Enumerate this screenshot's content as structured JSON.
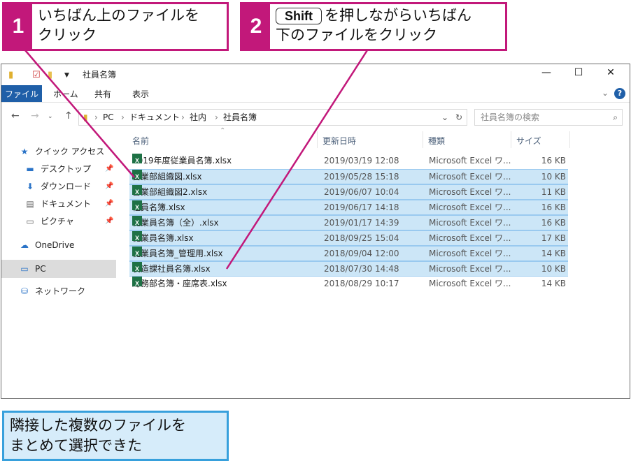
{
  "callouts": {
    "step1": {
      "num": "1",
      "text": "いちばん上のファイルを\nクリック"
    },
    "step2": {
      "num": "2",
      "key": "Shift",
      "text": "を押しながらいちばん",
      "text2": "下のファイルをクリック"
    },
    "result": "隣接した複数のファイルを\nまとめて選択できた"
  },
  "window": {
    "title": "社員名簿",
    "buttons": {
      "minimize": "—",
      "maximize": "☐",
      "close": "✕"
    },
    "ribbon_tabs": [
      "ファイル",
      "ホーム",
      "共有",
      "表示"
    ],
    "help": "?",
    "breadcrumb": [
      "PC",
      "ドキュメント",
      "社内",
      "社員名簿"
    ],
    "search_placeholder": "社員名簿の検索"
  },
  "nav": {
    "quick_access": "クイック アクセス",
    "items": [
      "デスクトップ",
      "ダウンロード",
      "ドキュメント",
      "ピクチャ"
    ],
    "onedrive": "OneDrive",
    "pc": "PC",
    "network": "ネットワーク"
  },
  "columns": {
    "name": "名前",
    "date": "更新日時",
    "type": "種類",
    "size": "サイズ"
  },
  "files": [
    {
      "name": "2019年度従業員名簿.xlsx",
      "date": "2019/03/19 12:08",
      "type": "Microsoft Excel ワ...",
      "size": "16 KB",
      "selected": false
    },
    {
      "name": "営業部組織図.xlsx",
      "date": "2019/05/28 15:18",
      "type": "Microsoft Excel ワ...",
      "size": "10 KB",
      "selected": true
    },
    {
      "name": "営業部組織図2.xlsx",
      "date": "2019/06/07 10:04",
      "type": "Microsoft Excel ワ...",
      "size": "11 KB",
      "selected": true
    },
    {
      "name": "社員名簿.xlsx",
      "date": "2019/06/17 14:18",
      "type": "Microsoft Excel ワ...",
      "size": "16 KB",
      "selected": true
    },
    {
      "name": "従業員名簿（全）.xlsx",
      "date": "2019/01/17 14:39",
      "type": "Microsoft Excel ワ...",
      "size": "16 KB",
      "selected": true
    },
    {
      "name": "従業員名簿.xlsx",
      "date": "2018/09/25 15:04",
      "type": "Microsoft Excel ワ...",
      "size": "17 KB",
      "selected": true
    },
    {
      "name": "従業員名簿_管理用.xlsx",
      "date": "2018/09/04 12:00",
      "type": "Microsoft Excel ワ...",
      "size": "14 KB",
      "selected": true
    },
    {
      "name": "製造課社員名簿.xlsx",
      "date": "2018/07/30 14:48",
      "type": "Microsoft Excel ワ...",
      "size": "10 KB",
      "selected": true
    },
    {
      "name": "総務部名簿・座席表.xlsx",
      "date": "2018/08/29 10:17",
      "type": "Microsoft Excel ワ...",
      "size": "14 KB",
      "selected": false
    }
  ],
  "colors": {
    "accent": "#c2187a",
    "selection": "#cce6f7",
    "result_border": "#37a0dc",
    "ribbon_file": "#1f5fa8"
  }
}
